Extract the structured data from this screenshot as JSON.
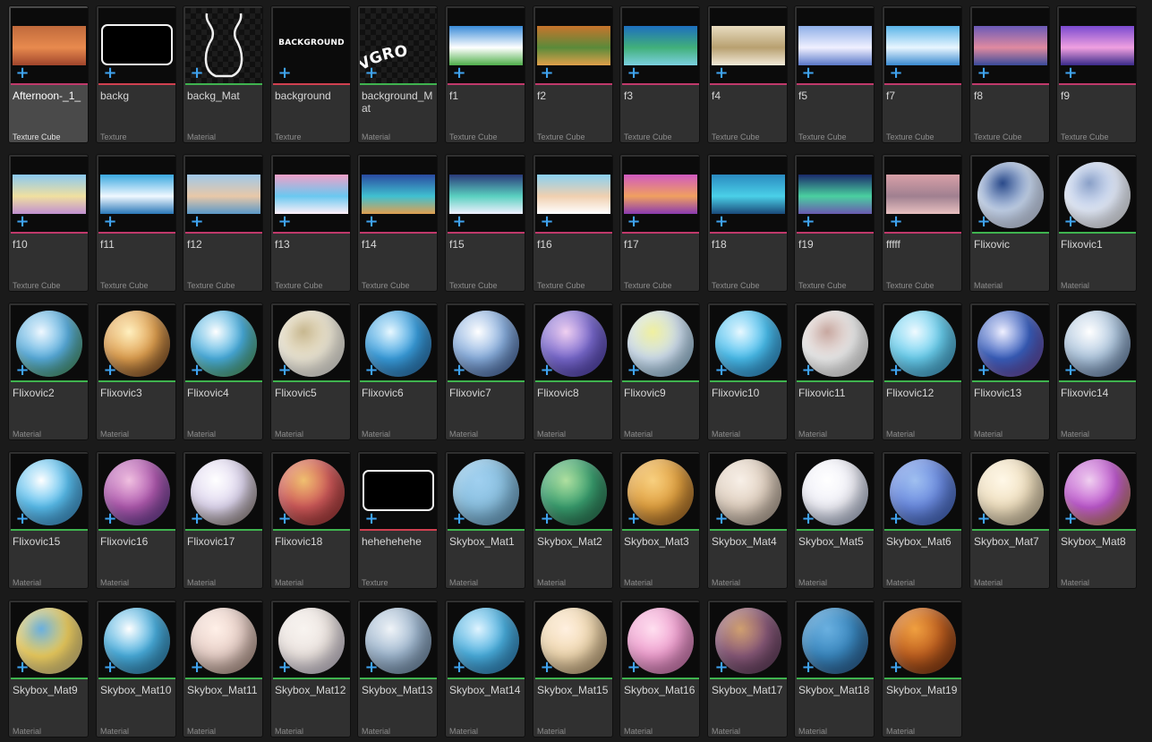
{
  "type_colors": {
    "Texture Cube": "#c0396b",
    "Texture": "#d04050",
    "Material": "#3fb34f"
  },
  "assets": [
    {
      "name": "Afternoon-_1_",
      "type": "Texture Cube",
      "thumb": "pano",
      "selected": true,
      "colors": [
        "#c06a3c",
        "#e88a4e",
        "#a0452c"
      ]
    },
    {
      "name": "backg",
      "type": "Texture",
      "thumb": "rrect"
    },
    {
      "name": "backg_Mat",
      "type": "Material",
      "thumb": "outline"
    },
    {
      "name": "background",
      "type": "Texture",
      "thumb": "bgtext",
      "text": "BACKGROUND"
    },
    {
      "name": "background_Mat",
      "type": "Material",
      "thumb": "warped",
      "text": "VGRO"
    },
    {
      "name": "f1",
      "type": "Texture Cube",
      "thumb": "pano",
      "colors": [
        "#3a8bd8",
        "#ffffff",
        "#4fae4a"
      ]
    },
    {
      "name": "f2",
      "type": "Texture Cube",
      "thumb": "pano",
      "colors": [
        "#c8742c",
        "#5a8a3a",
        "#e0a04a"
      ]
    },
    {
      "name": "f3",
      "type": "Texture Cube",
      "thumb": "pano",
      "colors": [
        "#1d6fbf",
        "#41b07a",
        "#7cd0e0"
      ]
    },
    {
      "name": "f4",
      "type": "Texture Cube",
      "thumb": "pano",
      "colors": [
        "#e8dcc0",
        "#b8a070",
        "#f2ead8"
      ]
    },
    {
      "name": "f5",
      "type": "Texture Cube",
      "thumb": "pano",
      "colors": [
        "#8fb0e8",
        "#f0f0ff",
        "#5a78c8"
      ]
    },
    {
      "name": "f7",
      "type": "Texture Cube",
      "thumb": "pano",
      "colors": [
        "#5ab4e8",
        "#e8f6ff",
        "#3a8ad0"
      ]
    },
    {
      "name": "f8",
      "type": "Texture Cube",
      "thumb": "pano",
      "colors": [
        "#6a5ab8",
        "#e08aa0",
        "#3a4a9a"
      ]
    },
    {
      "name": "f9",
      "type": "Texture Cube",
      "thumb": "pano",
      "colors": [
        "#7a4ad0",
        "#f0a0e0",
        "#3a2a8a"
      ]
    },
    {
      "name": "f10",
      "type": "Texture Cube",
      "thumb": "pano",
      "colors": [
        "#8ac8f0",
        "#f0e0a0",
        "#c090d0"
      ]
    },
    {
      "name": "f11",
      "type": "Texture Cube",
      "thumb": "pano",
      "colors": [
        "#3aa8e0",
        "#f0f8ff",
        "#2a78b8"
      ]
    },
    {
      "name": "f12",
      "type": "Texture Cube",
      "thumb": "pano",
      "colors": [
        "#a0c8e8",
        "#e8c8a8",
        "#5a98c8"
      ]
    },
    {
      "name": "f13",
      "type": "Texture Cube",
      "thumb": "pano",
      "colors": [
        "#f0a0c8",
        "#6ac8f0",
        "#fff0f8"
      ]
    },
    {
      "name": "f14",
      "type": "Texture Cube",
      "thumb": "pano",
      "colors": [
        "#2a4aa0",
        "#40c0d0",
        "#e0a050"
      ]
    },
    {
      "name": "f15",
      "type": "Texture Cube",
      "thumb": "pano",
      "colors": [
        "#2a3a7a",
        "#5ad0c0",
        "#f0f0ff"
      ]
    },
    {
      "name": "f16",
      "type": "Texture Cube",
      "thumb": "pano",
      "colors": [
        "#8ad0f0",
        "#f0d0b0",
        "#ffffff"
      ]
    },
    {
      "name": "f17",
      "type": "Texture Cube",
      "thumb": "pano",
      "colors": [
        "#d05ac0",
        "#f0a060",
        "#8a3ab0"
      ]
    },
    {
      "name": "f18",
      "type": "Texture Cube",
      "thumb": "pano",
      "colors": [
        "#2a8ac0",
        "#4ad0e8",
        "#1a4a7a"
      ]
    },
    {
      "name": "f19",
      "type": "Texture Cube",
      "thumb": "pano",
      "colors": [
        "#1a2a6a",
        "#4ad0a0",
        "#6a5ab0"
      ]
    },
    {
      "name": "fffff",
      "type": "Texture Cube",
      "thumb": "pano",
      "colors": [
        "#d8a0a8",
        "#a08090",
        "#e8c0c0"
      ]
    },
    {
      "name": "Flixovic",
      "type": "Material",
      "thumb": "sphere",
      "colors": [
        "#c8d8f0",
        "#2a4a8a",
        "#e0e8ff"
      ]
    },
    {
      "name": "Flixovic1",
      "type": "Material",
      "thumb": "sphere",
      "colors": [
        "#e8f0ff",
        "#8aa0c8",
        "#ffffff"
      ]
    },
    {
      "name": "Flixovic2",
      "type": "Material",
      "thumb": "sphere",
      "colors": [
        "#5ab0e0",
        "#f0f8ff",
        "#4aa04a"
      ]
    },
    {
      "name": "Flixovic3",
      "type": "Material",
      "thumb": "sphere",
      "colors": [
        "#e0a050",
        "#fff0c0",
        "#6a3a1a"
      ]
    },
    {
      "name": "Flixovic4",
      "type": "Material",
      "thumb": "sphere",
      "colors": [
        "#4ab0e0",
        "#ffffff",
        "#5ab04a"
      ]
    },
    {
      "name": "Flixovic5",
      "type": "Material",
      "thumb": "sphere",
      "colors": [
        "#f0ead8",
        "#c8b890",
        "#ffffff"
      ]
    },
    {
      "name": "Flixovic6",
      "type": "Material",
      "thumb": "sphere",
      "colors": [
        "#3aa0e0",
        "#e8f8ff",
        "#2a70b0"
      ]
    },
    {
      "name": "Flixovic7",
      "type": "Material",
      "thumb": "sphere",
      "colors": [
        "#8ab0e0",
        "#ffffff",
        "#3a5a9a"
      ]
    },
    {
      "name": "Flixovic8",
      "type": "Material",
      "thumb": "sphere",
      "colors": [
        "#7a6ad0",
        "#f0d0f0",
        "#4a3ab0"
      ]
    },
    {
      "name": "Flixovic9",
      "type": "Material",
      "thumb": "sphere",
      "colors": [
        "#d0e0f0",
        "#f0f0a0",
        "#8ac0e0"
      ]
    },
    {
      "name": "Flixovic10",
      "type": "Material",
      "thumb": "sphere",
      "colors": [
        "#4ac0f0",
        "#e8f8ff",
        "#2a8ad0"
      ]
    },
    {
      "name": "Flixovic11",
      "type": "Material",
      "thumb": "sphere",
      "colors": [
        "#f0f0f0",
        "#c8a8a0",
        "#ffffff"
      ]
    },
    {
      "name": "Flixovic12",
      "type": "Material",
      "thumb": "sphere",
      "colors": [
        "#6ad0f0",
        "#f0faff",
        "#3aa0d0"
      ]
    },
    {
      "name": "Flixovic13",
      "type": "Material",
      "thumb": "sphere",
      "colors": [
        "#3a60c0",
        "#f0f0ff",
        "#8a4ab0"
      ]
    },
    {
      "name": "Flixovic14",
      "type": "Material",
      "thumb": "sphere",
      "colors": [
        "#b0c8e0",
        "#ffffff",
        "#5a7aa8"
      ]
    },
    {
      "name": "Flixovic15",
      "type": "Material",
      "thumb": "sphere",
      "colors": [
        "#5ac0f0",
        "#ffffff",
        "#3a90d0"
      ]
    },
    {
      "name": "Flixovic16",
      "type": "Material",
      "thumb": "sphere",
      "colors": [
        "#b05ab0",
        "#f0c0e0",
        "#5a3a9a"
      ]
    },
    {
      "name": "Flixovic17",
      "type": "Material",
      "thumb": "sphere",
      "colors": [
        "#e0d8f0",
        "#ffffff",
        "#8a7a6a"
      ]
    },
    {
      "name": "Flixovic18",
      "type": "Material",
      "thumb": "sphere",
      "colors": [
        "#d05a5a",
        "#f0c070",
        "#a03030"
      ]
    },
    {
      "name": "hehehehehe",
      "type": "Texture",
      "thumb": "rrect"
    },
    {
      "name": "Skybox_Mat1",
      "type": "Material",
      "thumb": "sphere",
      "colors": [
        "#8ac0e0",
        "#a0d0f0",
        "#6aa8d0"
      ]
    },
    {
      "name": "Skybox_Mat2",
      "type": "Material",
      "thumb": "sphere",
      "colors": [
        "#3aa070",
        "#b0e0a0",
        "#2a7050"
      ]
    },
    {
      "name": "Skybox_Mat3",
      "type": "Material",
      "thumb": "sphere",
      "colors": [
        "#e0a040",
        "#f8d080",
        "#a06020"
      ]
    },
    {
      "name": "Skybox_Mat4",
      "type": "Material",
      "thumb": "sphere",
      "colors": [
        "#e0d0c0",
        "#f8f0e8",
        "#b0a090"
      ]
    },
    {
      "name": "Skybox_Mat5",
      "type": "Material",
      "thumb": "sphere",
      "colors": [
        "#f0f0f8",
        "#ffffff",
        "#a0b0d0"
      ]
    },
    {
      "name": "Skybox_Mat6",
      "type": "Material",
      "thumb": "sphere",
      "colors": [
        "#6a8ae0",
        "#a0c0f0",
        "#3a60c0"
      ]
    },
    {
      "name": "Skybox_Mat7",
      "type": "Material",
      "thumb": "sphere",
      "colors": [
        "#f0e0c0",
        "#fff8e8",
        "#d0c0a0"
      ]
    },
    {
      "name": "Skybox_Mat8",
      "type": "Material",
      "thumb": "sphere",
      "colors": [
        "#c05ad0",
        "#f0d0f0",
        "#e0a040"
      ]
    },
    {
      "name": "Skybox_Mat9",
      "type": "Material",
      "thumb": "sphere",
      "colors": [
        "#f0d060",
        "#6ab0e0",
        "#f0e0a0"
      ]
    },
    {
      "name": "Skybox_Mat10",
      "type": "Material",
      "thumb": "sphere",
      "colors": [
        "#4ab0e0",
        "#ffffff",
        "#2a80b0"
      ]
    },
    {
      "name": "Skybox_Mat11",
      "type": "Material",
      "thumb": "sphere",
      "colors": [
        "#e8d0c8",
        "#fff0e8",
        "#b09080"
      ]
    },
    {
      "name": "Skybox_Mat12",
      "type": "Material",
      "thumb": "sphere",
      "colors": [
        "#ece4e0",
        "#f8f4f0",
        "#d0c8e0"
      ]
    },
    {
      "name": "Skybox_Mat13",
      "type": "Material",
      "thumb": "sphere",
      "colors": [
        "#a0b8d0",
        "#f0f4f8",
        "#6a88a8"
      ]
    },
    {
      "name": "Skybox_Mat14",
      "type": "Material",
      "thumb": "sphere",
      "colors": [
        "#4ab0e0",
        "#e0f4ff",
        "#2a80c0"
      ]
    },
    {
      "name": "Skybox_Mat15",
      "type": "Material",
      "thumb": "sphere",
      "colors": [
        "#f0d8b0",
        "#fff0e0",
        "#c0a070"
      ]
    },
    {
      "name": "Skybox_Mat16",
      "type": "Material",
      "thumb": "sphere",
      "colors": [
        "#f0a0d0",
        "#ffe0f0",
        "#d070b0"
      ]
    },
    {
      "name": "Skybox_Mat17",
      "type": "Material",
      "thumb": "sphere",
      "colors": [
        "#8a5a7a",
        "#d0a070",
        "#5a3a5a"
      ]
    },
    {
      "name": "Skybox_Mat18",
      "type": "Material",
      "thumb": "sphere",
      "colors": [
        "#3a88c0",
        "#6ab0e0",
        "#2a5a90"
      ]
    },
    {
      "name": "Skybox_Mat19",
      "type": "Material",
      "thumb": "sphere",
      "colors": [
        "#c06020",
        "#f0a040",
        "#7a3010"
      ]
    }
  ]
}
